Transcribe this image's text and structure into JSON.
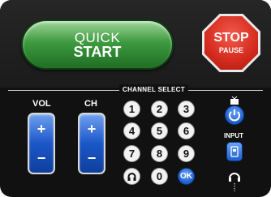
{
  "quick_start": {
    "line1": "QUICK",
    "line2": "START"
  },
  "stop": {
    "line1": "STOP",
    "line2": "PAUSE"
  },
  "channel_select_label": "CHANNEL SELECT",
  "vol_label": "VOL",
  "ch_label": "CH",
  "rocker": {
    "up": "+",
    "down": "−"
  },
  "keypad": {
    "k1": "1",
    "k2": "2",
    "k3": "3",
    "k4": "4",
    "k5": "5",
    "k6": "6",
    "k7": "7",
    "k8": "8",
    "k9": "9",
    "k0": "0",
    "ok": "OK"
  },
  "input_label": "INPUT",
  "icons": {
    "tv": "tv-icon",
    "power": "power-icon",
    "input": "input-icon",
    "headphone": "headphone-icon",
    "return": "return-icon"
  },
  "colors": {
    "quick_start_green": "#3d9a3f",
    "stop_red": "#d42a1d",
    "button_blue": "#1d5fd0",
    "panel_black": "#111111"
  }
}
